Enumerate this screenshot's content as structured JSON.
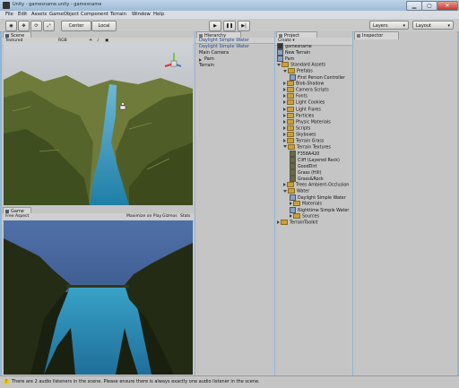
{
  "window": {
    "title": "Unity - gamesname.unity - gamesname"
  },
  "menu": [
    "File",
    "Edit",
    "Assets",
    "GameObject",
    "Component",
    "Terrain",
    "Window",
    "Help"
  ],
  "toolbar": {
    "center_label": "Center",
    "local_label": "Local",
    "layers_label": "Layers",
    "layout_label": "Layout"
  },
  "scene_panel": {
    "tab": "Scene",
    "render_mode": "Textured",
    "color_mode": "RGB"
  },
  "game_panel": {
    "tab": "Game",
    "aspect": "Free Aspect",
    "maximize": "Maximize on Play",
    "gizmos": "Gizmos",
    "stats": "Stats"
  },
  "hierarchy": {
    "tab": "Hierarchy",
    "create": "Create",
    "items": [
      "Daylight Simple Water",
      "Daylight Simple Water",
      "Main Camera",
      "Pam",
      "Terrain"
    ]
  },
  "project": {
    "tab": "Project",
    "create": "Create",
    "items": [
      {
        "label": "gamesname",
        "kind": "scene",
        "indent": 0
      },
      {
        "label": "New Terrain",
        "kind": "asset",
        "indent": 0
      },
      {
        "label": "Pam",
        "kind": "asset",
        "indent": 0
      },
      {
        "label": "Standard Assets",
        "kind": "folder-open",
        "indent": 0
      },
      {
        "label": "Prefabs",
        "kind": "folder-open",
        "indent": 1
      },
      {
        "label": "First Person Controller",
        "kind": "asset",
        "indent": 2
      },
      {
        "label": "Blob-Shadow",
        "kind": "folder",
        "indent": 1
      },
      {
        "label": "Camera Scripts",
        "kind": "folder",
        "indent": 1
      },
      {
        "label": "Fonts",
        "kind": "folder",
        "indent": 1
      },
      {
        "label": "Light Cookies",
        "kind": "folder",
        "indent": 1
      },
      {
        "label": "Light Flares",
        "kind": "folder",
        "indent": 1
      },
      {
        "label": "Particles",
        "kind": "folder",
        "indent": 1
      },
      {
        "label": "Physic Materials",
        "kind": "folder",
        "indent": 1
      },
      {
        "label": "Scripts",
        "kind": "folder",
        "indent": 1
      },
      {
        "label": "Skyboxes",
        "kind": "folder",
        "indent": 1
      },
      {
        "label": "Terrain Grass",
        "kind": "folder",
        "indent": 1
      },
      {
        "label": "Terrain Textures",
        "kind": "folder-open",
        "indent": 1
      },
      {
        "label": "F358A420",
        "kind": "texture",
        "indent": 2
      },
      {
        "label": "Cliff (Layered Rock)",
        "kind": "texture",
        "indent": 2
      },
      {
        "label": "GoodDirt",
        "kind": "texture",
        "indent": 2
      },
      {
        "label": "Grass (Hill)",
        "kind": "texture",
        "indent": 2
      },
      {
        "label": "Grass&Rock",
        "kind": "texture",
        "indent": 2
      },
      {
        "label": "Trees Ambient-Occlusion",
        "kind": "folder",
        "indent": 1
      },
      {
        "label": "Water",
        "kind": "folder-open",
        "indent": 1
      },
      {
        "label": "Daylight Simple Water",
        "kind": "asset",
        "indent": 2
      },
      {
        "label": "Materials",
        "kind": "folder",
        "indent": 2
      },
      {
        "label": "Nighttime Simple Water",
        "kind": "asset",
        "indent": 2
      },
      {
        "label": "Sources",
        "kind": "folder",
        "indent": 2
      },
      {
        "label": "TerrainToolkit",
        "kind": "folder",
        "indent": 0
      }
    ]
  },
  "inspector": {
    "tab": "Inspector"
  },
  "status": {
    "message": "There are 2 audio listeners in the scene. Please ensure there is always exactly one audio listener in the scene."
  },
  "colors": {
    "terrain": "#5b6b2e",
    "water": "#2f8fb8",
    "sky": "#5877a8",
    "panel": "#c5c5c5"
  }
}
